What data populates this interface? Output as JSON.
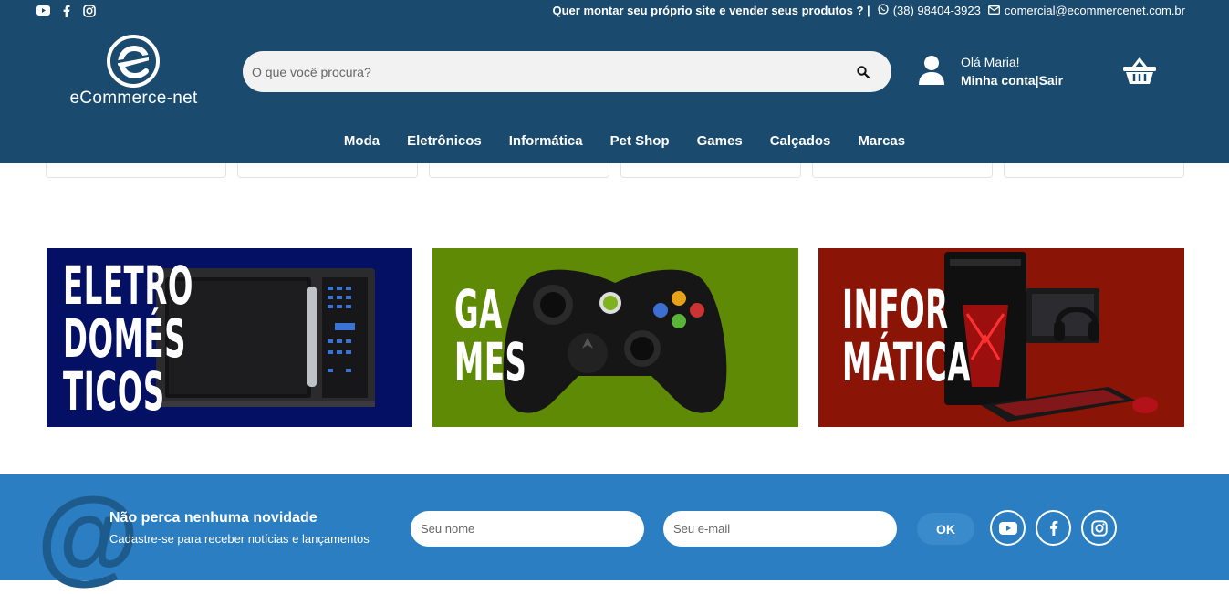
{
  "topbar": {
    "tagline": "Quer montar seu próprio site e vender seus produtos ? |",
    "phone": "(38) 98404-3923",
    "email": "comercial@ecommercenet.com.br",
    "social_icons": [
      "youtube-icon",
      "facebook-icon",
      "instagram-icon"
    ]
  },
  "brand": {
    "logo_text": "eCommerce-net"
  },
  "search": {
    "placeholder": "O que você procura?"
  },
  "user": {
    "greeting": "Olá Maria!",
    "account_link": "Minha conta",
    "separator": "|",
    "logout_link": "Sair"
  },
  "nav": {
    "items": [
      "Moda",
      "Eletrônicos",
      "Informática",
      "Pet Shop",
      "Games",
      "Calçados",
      "Marcas"
    ]
  },
  "banners": [
    {
      "lines": [
        "ELETRO",
        "DOMÉS",
        "TICOS"
      ],
      "bg": "#041063"
    },
    {
      "lines": [
        "GA",
        "MES"
      ],
      "bg": "#5e8a05"
    },
    {
      "lines": [
        "INFOR",
        "MÁTICA"
      ],
      "bg": "#8a1405"
    }
  ],
  "newsletter": {
    "title": "Não perca nenhuma novidade",
    "subtitle": "Cadastre-se para receber notícias e lançamentos",
    "name_placeholder": "Seu nome",
    "email_placeholder": "Seu e-mail",
    "submit_label": "OK",
    "at_symbol": "@"
  },
  "colors": {
    "header": "#1a4a6e",
    "newsletter": "#2b7ec1"
  }
}
